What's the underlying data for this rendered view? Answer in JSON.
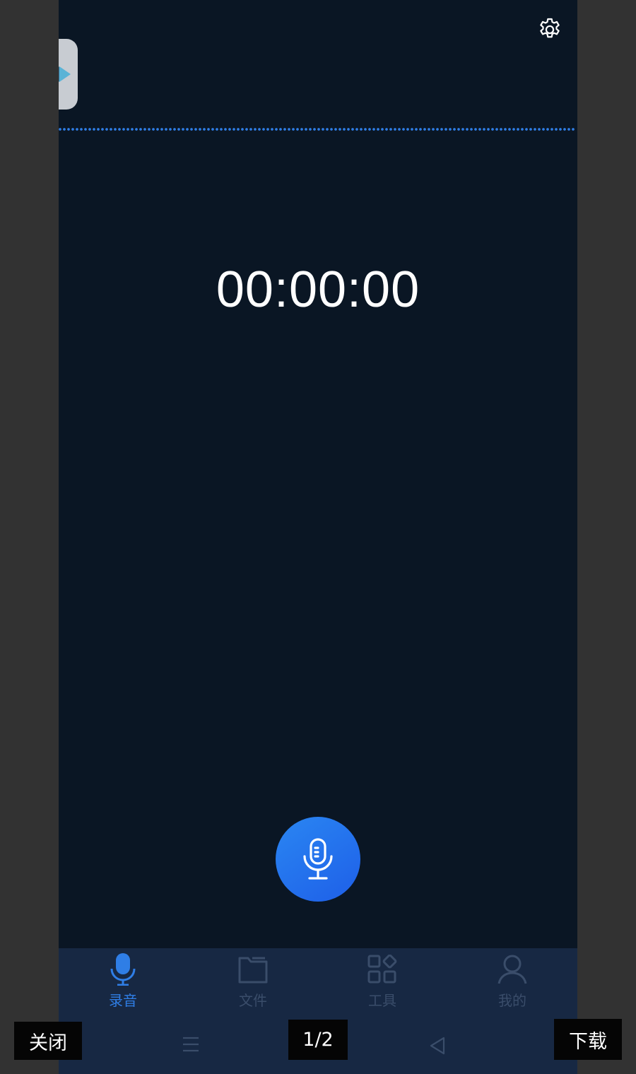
{
  "timer": {
    "value": "00:00:00"
  },
  "icons": {
    "settings": "gear-icon",
    "floating_widget": "app-shortcut-icon",
    "record": "microphone-icon",
    "menu": "menu-icon",
    "home": "home-icon",
    "back": "back-icon"
  },
  "tabs": [
    {
      "label": "录音",
      "icon": "microphone-icon",
      "active": true
    },
    {
      "label": "文件",
      "icon": "folder-icon",
      "active": false
    },
    {
      "label": "工具",
      "icon": "tools-grid-icon",
      "active": false
    },
    {
      "label": "我的",
      "icon": "user-icon",
      "active": false
    }
  ],
  "viewer": {
    "close_label": "关闭",
    "page_indicator": "1/2",
    "download_label": "下载"
  },
  "colors": {
    "app_background": "#0a1624",
    "accent": "#2f7ee6",
    "tabbar_background": "#172843",
    "inactive_tab": "#3a4d6a",
    "viewer_background": "#323232"
  }
}
